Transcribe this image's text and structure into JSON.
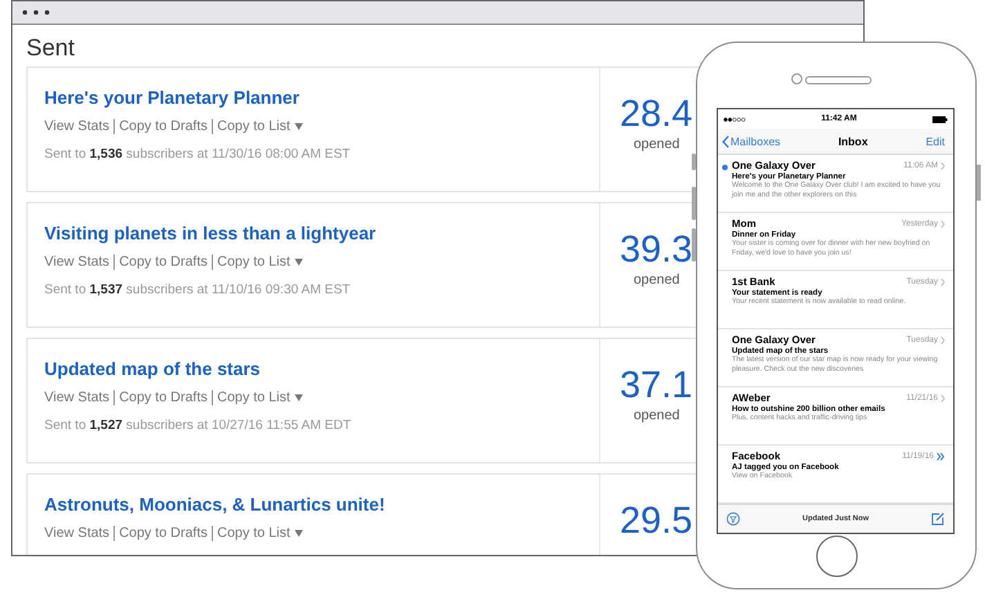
{
  "window": {
    "title": "Sent"
  },
  "campaigns": [
    {
      "title": "Here's your Planetary Planner",
      "actions": [
        "View Stats",
        "Copy to Drafts",
        "Copy to List"
      ],
      "sent": "Sent to **1,536** subscribers at 11/30/16 08:00 AM EST",
      "rate": "28.4",
      "rate_label": "opened"
    },
    {
      "title": "Visiting planets in less than a lightyear",
      "actions": [
        "View Stats",
        "Copy to Drafts",
        "Copy to List"
      ],
      "sent": "Sent to **1,537** subscribers at 11/10/16 09:30 AM EST",
      "rate": "39.3",
      "rate_label": "opened"
    },
    {
      "title": "Updated map of the stars",
      "actions": [
        "View Stats",
        "Copy to Drafts",
        "Copy to List"
      ],
      "sent": "Sent to **1,527** subscribers at 10/27/16 11:55 AM EDT",
      "rate": "37.1",
      "rate_label": "opened"
    },
    {
      "title": "Astronuts, Mooniacs, & Lunartics unite!",
      "actions": [
        "View Stats",
        "Copy to Drafts",
        "Copy to List"
      ],
      "rate": "29.5"
    }
  ],
  "phone": {
    "status_time": "11:42 AM",
    "back": "Mailboxes",
    "title": "Inbox",
    "edit": "Edit",
    "emails": [
      {
        "sender": "One Galaxy Over",
        "time": "11:06 AM",
        "subject": "Here's your Planetary Planner",
        "preview": "Welcome to the One Galaxy Over club! I am excited to have you join me and the other explorers on this",
        "unread": true,
        "kind": "chevron"
      },
      {
        "sender": "Mom",
        "time": "Yesterday",
        "subject": "Dinner on Friday",
        "preview": "Your sister is coming over for dinner with her new boyfried on Friday, we'd love to have you join us!",
        "unread": false,
        "kind": "chevron"
      },
      {
        "sender": "1st Bank",
        "time": "Tuesday",
        "subject": "Your statement is ready",
        "preview": "Your recent statement is now available to read online.",
        "unread": false,
        "kind": "chevron"
      },
      {
        "sender": "One Galaxy Over",
        "time": "Tuesday",
        "subject": "Updated map of the stars",
        "preview": "The latest version of our star map is now ready for your viewing pleasure. Check out the new discoveries",
        "unread": false,
        "kind": "chevron"
      },
      {
        "sender": "AWeber",
        "time": "11/21/16",
        "subject": "How to outshine 200 billion other emails",
        "preview": "Plus, content hacks and traffic-driving tips",
        "unread": false,
        "kind": "chevron"
      },
      {
        "sender": "Facebook",
        "time": "11/19/16",
        "subject": "AJ tagged you on Facebook",
        "preview": "View on Facebook",
        "unread": false,
        "kind": "double-chevron"
      }
    ],
    "toolbar_status": "Updated Just Now"
  }
}
